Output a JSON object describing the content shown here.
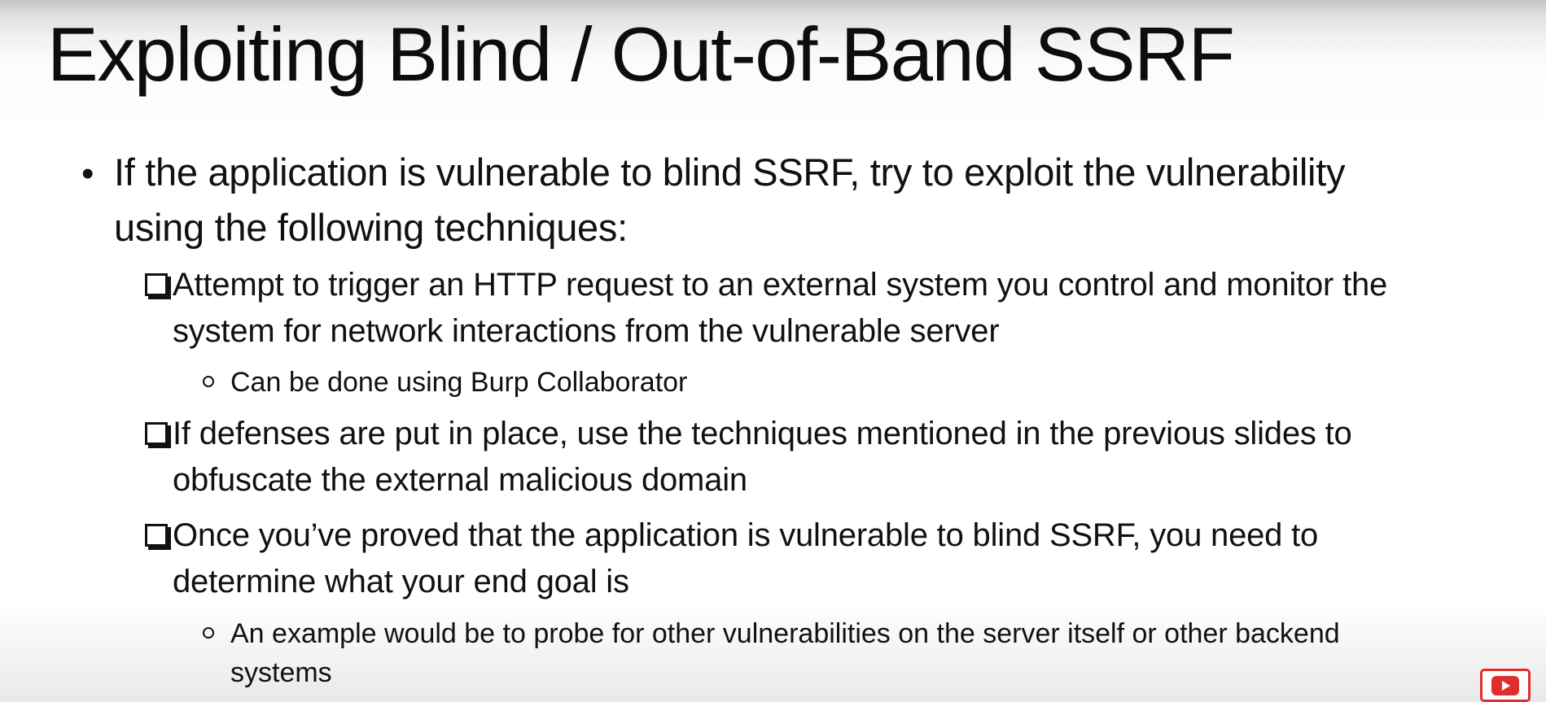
{
  "slide": {
    "title": "Exploiting Blind / Out-of-Band SSRF",
    "bullets": [
      {
        "marker": "•",
        "text": "If the application is vulnerable to blind SSRF, try to exploit the vulnerability using the following techniques:",
        "items": [
          {
            "marker": "checkbox",
            "text": "Attempt to trigger an HTTP request to an external system you control and monitor the system for network interactions from the vulnerable server",
            "subitems": [
              {
                "marker": "o",
                "text": "Can be done using Burp Collaborator"
              }
            ]
          },
          {
            "marker": "checkbox",
            "text": "If defenses are put in place, use the techniques mentioned in the previous slides to obfuscate the external malicious domain",
            "subitems": []
          },
          {
            "marker": "checkbox",
            "text": "Once you’ve proved that the application is vulnerable to blind SSRF, you need to determine what your end goal is",
            "subitems": [
              {
                "marker": "o",
                "text": "An example would be to probe for other vulnerabilities on the server itself or other backend systems"
              }
            ]
          }
        ]
      }
    ]
  },
  "player": {
    "button_icon": "youtube-play-icon",
    "accent_color": "#e02e2e"
  }
}
